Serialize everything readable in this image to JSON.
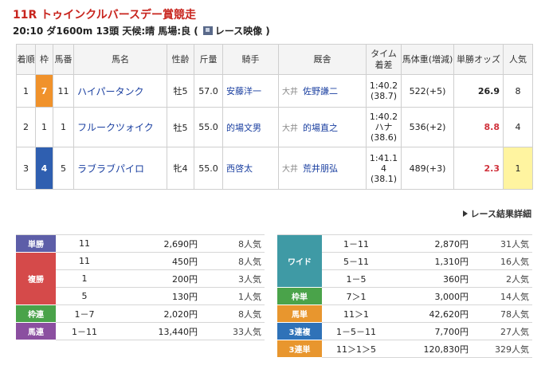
{
  "race": {
    "title": "11R トゥインクルバースデー賞競走",
    "info": "20:10 ダ1600m 13頭  天候:晴 馬場:良  (",
    "video_label": "レース映像",
    "info_close": ")"
  },
  "results": {
    "headers": {
      "rank": "着順",
      "waku": "枠",
      "num": "馬番",
      "horse": "馬名",
      "sexage": "性齢",
      "weight": "斤量",
      "jockey": "騎手",
      "trainer": "厩舎",
      "time": "タイム着差",
      "body": "馬体重(増減)",
      "odds": "単勝オッズ",
      "pop": "人気"
    },
    "rows": [
      {
        "rank": "1",
        "waku": "7",
        "num": "11",
        "horse": "ハイパータンク",
        "sexage": "牡5",
        "weight": "57.0",
        "jockey": "安藤洋一",
        "trainer_pre": "大井",
        "trainer": "佐野謙二",
        "time": "1:40.2",
        "margin": "(38.7)",
        "body": "522(+5)",
        "odds": "26.9",
        "pop": "8"
      },
      {
        "rank": "2",
        "waku": "1",
        "num": "1",
        "horse": "フルークツォイク",
        "sexage": "牡5",
        "weight": "55.0",
        "jockey": "的場文男",
        "trainer_pre": "大井",
        "trainer": "的場直之",
        "time": "1:40.2",
        "margin": "ハナ",
        "margin2": "(38.6)",
        "body": "536(+2)",
        "odds": "8.8",
        "pop": "4"
      },
      {
        "rank": "3",
        "waku": "4",
        "num": "5",
        "horse": "ラブラブパイロ",
        "sexage": "牝4",
        "weight": "55.0",
        "jockey": "西啓太",
        "trainer_pre": "大井",
        "trainer": "荒井朋弘",
        "time": "1:41.1",
        "margin": "4",
        "margin2": "(38.1)",
        "body": "489(+3)",
        "odds": "2.3",
        "pop": "1"
      }
    ]
  },
  "detail_link": "レース結果詳細",
  "payouts_left": [
    {
      "label": "単勝",
      "rows": [
        {
          "combo": "11",
          "yen": "2,690円",
          "pop": "8人気"
        }
      ]
    },
    {
      "label": "複勝",
      "rows": [
        {
          "combo": "11",
          "yen": "450円",
          "pop": "8人気"
        },
        {
          "combo": "1",
          "yen": "200円",
          "pop": "3人気"
        },
        {
          "combo": "5",
          "yen": "130円",
          "pop": "1人気"
        }
      ]
    },
    {
      "label": "枠連",
      "rows": [
        {
          "combo": "1－7",
          "yen": "2,020円",
          "pop": "8人気"
        }
      ]
    },
    {
      "label": "馬連",
      "rows": [
        {
          "combo": "1－11",
          "yen": "13,440円",
          "pop": "33人気"
        }
      ]
    }
  ],
  "payouts_right": [
    {
      "label": "ワイド",
      "rows": [
        {
          "combo": "1－11",
          "yen": "2,870円",
          "pop": "31人気"
        },
        {
          "combo": "5－11",
          "yen": "1,310円",
          "pop": "16人気"
        },
        {
          "combo": "1－5",
          "yen": "360円",
          "pop": "2人気"
        }
      ]
    },
    {
      "label": "枠単",
      "rows": [
        {
          "combo": "7＞1",
          "yen": "3,000円",
          "pop": "14人気"
        }
      ]
    },
    {
      "label": "馬単",
      "rows": [
        {
          "combo": "11＞1",
          "yen": "42,620円",
          "pop": "78人気"
        }
      ]
    },
    {
      "label": "3連複",
      "rows": [
        {
          "combo": "1－5－11",
          "yen": "7,700円",
          "pop": "27人気"
        }
      ]
    },
    {
      "label": "3連単",
      "rows": [
        {
          "combo": "11＞1＞5",
          "yen": "120,830円",
          "pop": "329人気"
        }
      ]
    }
  ]
}
